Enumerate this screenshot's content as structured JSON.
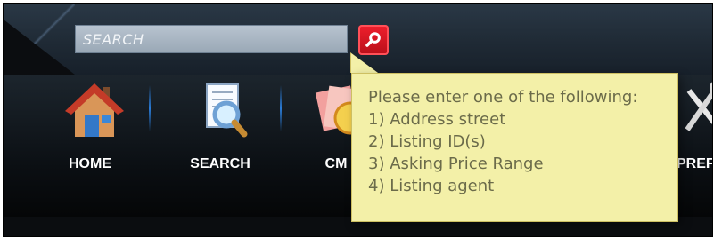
{
  "search": {
    "placeholder": "SEARCH",
    "button_icon": "magnifier-icon",
    "button_color": "#d51722"
  },
  "navigation": {
    "items": [
      {
        "label": "HOME",
        "icon": "house-icon"
      },
      {
        "label": "SEARCH",
        "icon": "search-document-icon"
      },
      {
        "label": "CM",
        "icon": "cma-icon"
      },
      {
        "label": "PREFE",
        "icon": "tools-icon"
      }
    ]
  },
  "tooltip": {
    "title": "Please enter one of the following:",
    "options": [
      "1) Address street",
      "2) Listing ID(s)",
      "3) Asking Price Range",
      "4) Listing agent"
    ]
  },
  "colors": {
    "toolbar_background": "#1f2a35",
    "tooltip_background": "#f3f0a8",
    "accent": "#2a7bd6"
  }
}
